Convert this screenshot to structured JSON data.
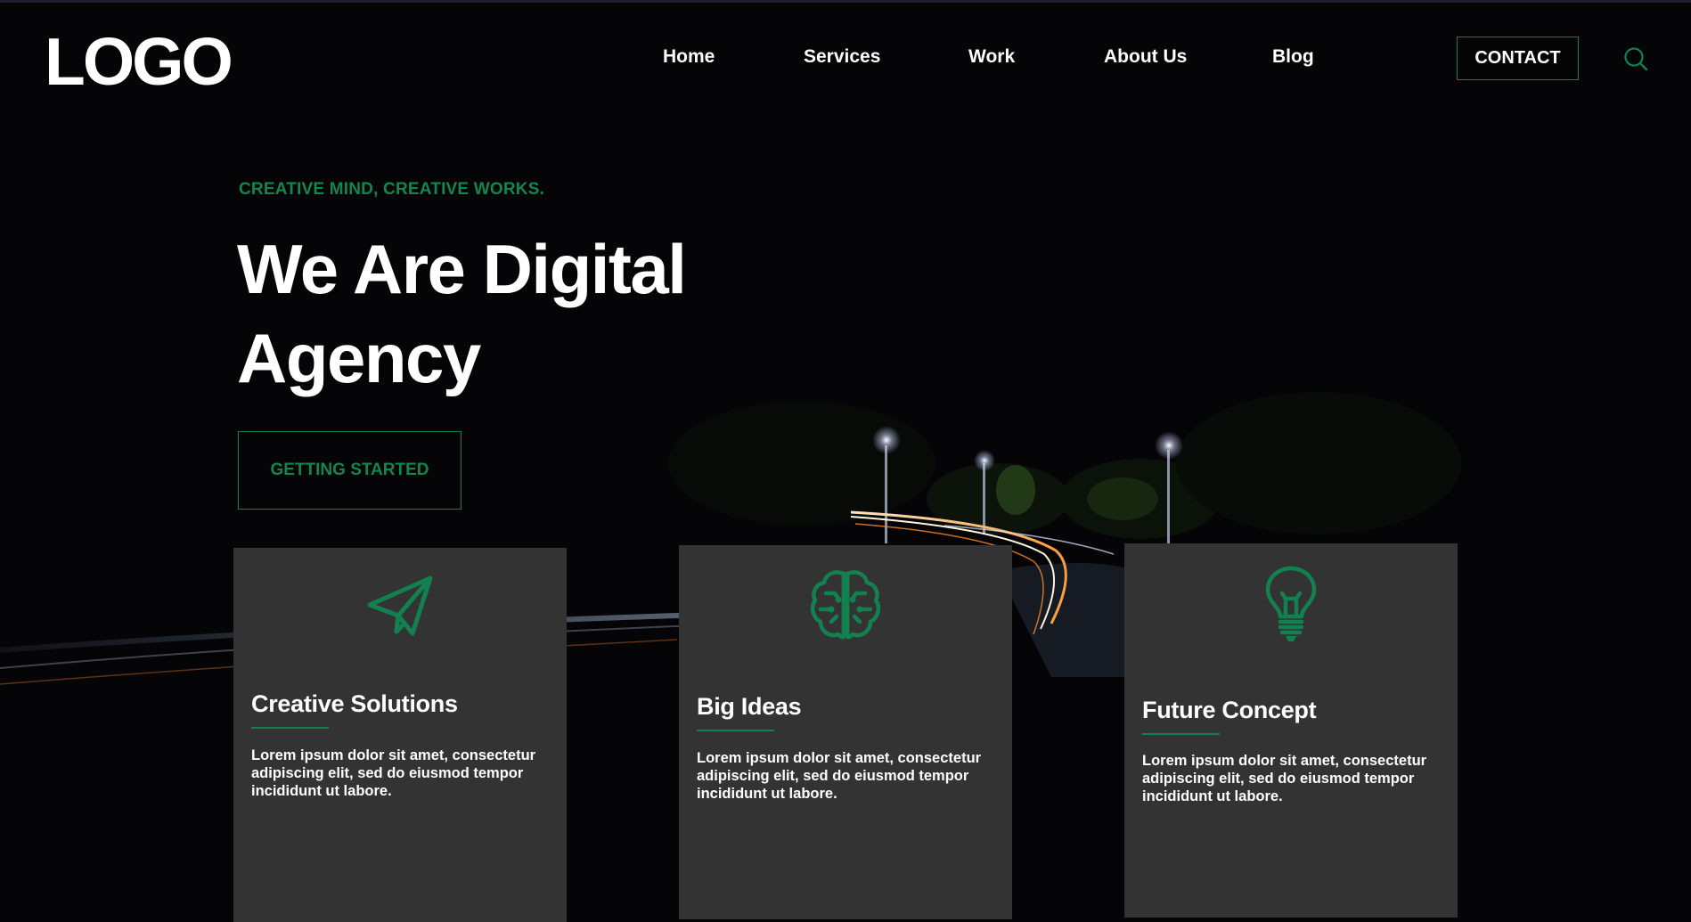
{
  "header": {
    "logo": "LOGO",
    "nav": [
      {
        "label": "Home"
      },
      {
        "label": "Services"
      },
      {
        "label": "Work"
      },
      {
        "label": "About Us"
      },
      {
        "label": "Blog"
      }
    ],
    "contact_label": "CONTACT",
    "search_icon": "search-icon"
  },
  "hero": {
    "tagline": "CREATIVE MIND, CREATIVE WORKS.",
    "title_line1": "We Are Digital",
    "title_line2": "Agency",
    "cta_label": "GETTING STARTED"
  },
  "cards": [
    {
      "icon": "paper-plane-icon",
      "title": "Creative Solutions",
      "text": "Lorem ipsum dolor sit amet, consectetur adipiscing elit, sed do eiusmod tempor incididunt ut labore."
    },
    {
      "icon": "brain-icon",
      "title": "Big Ideas",
      "text": "Lorem ipsum dolor sit amet, consectetur adipiscing elit, sed do eiusmod tempor incididunt ut labore."
    },
    {
      "icon": "lightbulb-icon",
      "title": "Future Concept",
      "text": "Lorem ipsum dolor sit amet, consectetur adipiscing elit, sed do eiusmod tempor incididunt ut labore."
    }
  ],
  "colors": {
    "accent": "#12814f",
    "background": "#050507",
    "card": "#333333",
    "text": "#ffffff"
  }
}
